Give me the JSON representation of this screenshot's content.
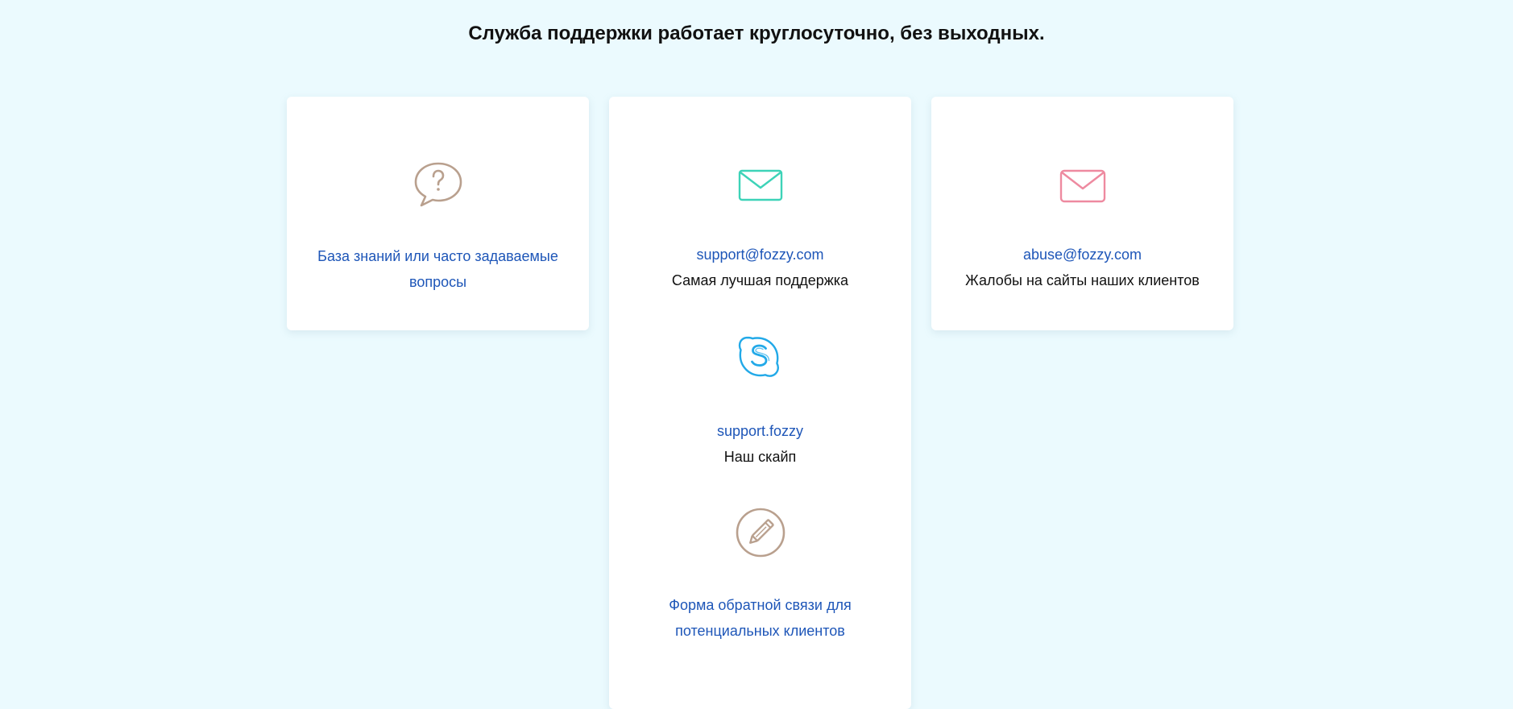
{
  "heading": "Служба поддержки работает круглосуточно, без выходных.",
  "cards": {
    "knowledge": {
      "icon": "question-bubble-icon",
      "link": "База знаний или часто задаваемые вопросы"
    },
    "support": {
      "email": {
        "icon": "envelope-icon",
        "link": "support@fozzy.com",
        "desc": "Самая лучшая поддержка"
      },
      "skype": {
        "icon": "skype-icon",
        "link": "support.fozzy",
        "desc": "Наш скайп"
      },
      "form": {
        "icon": "pencil-circle-icon",
        "link": "Форма обратной связи для потенциальных клиентов"
      }
    },
    "abuse": {
      "icon": "envelope-icon",
      "link": "abuse@fozzy.com",
      "desc": "Жалобы на сайты наших клиентов"
    }
  },
  "colors": {
    "background": "#ebfafe",
    "link": "#1e56b8",
    "icon_brown": "#b9a08e",
    "icon_teal": "#3dd3b8",
    "icon_skype": "#22a9e8",
    "icon_pink": "#ee8aa0"
  }
}
